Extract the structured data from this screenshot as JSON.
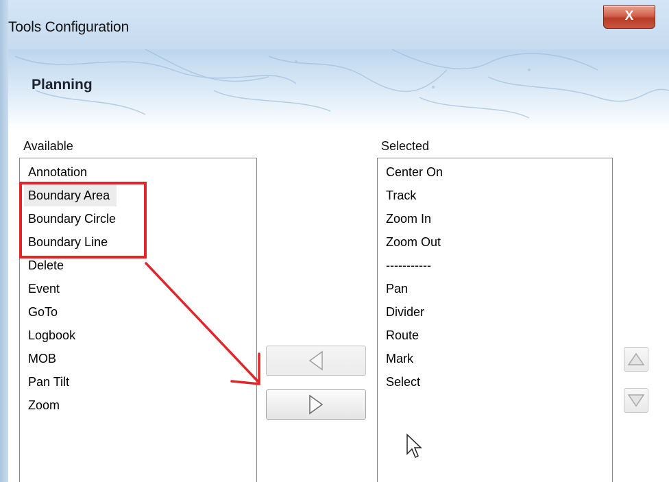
{
  "window": {
    "title": "Tools Configuration",
    "close_label": "X"
  },
  "banner": {
    "title": "Planning"
  },
  "available": {
    "label": "Available",
    "items": [
      "Annotation",
      "Boundary Area",
      "Boundary Circle",
      "Boundary Line",
      "Delete",
      "Event",
      "GoTo",
      "Logbook",
      "MOB",
      "Pan Tilt",
      "Zoom"
    ],
    "highlighted_item": "Boundary Area"
  },
  "selected": {
    "label": "Selected",
    "items": [
      "Center On",
      "Track",
      "Zoom In",
      "Zoom Out",
      "-----------",
      "Pan",
      "Divider",
      "Route",
      "Mark",
      "Select"
    ]
  },
  "buttons": {
    "remove_icon": "triangle-left-icon",
    "add_icon": "triangle-right-icon",
    "move_up_icon": "triangle-up-icon",
    "move_down_icon": "triangle-down-icon"
  },
  "annotation": {
    "color": "#e0262b",
    "icon": "red-arrow-annotation"
  },
  "colors": {
    "titlebar": "#c7dbef",
    "close_button": "#c9553e",
    "banner_top": "#bdd6ee"
  }
}
